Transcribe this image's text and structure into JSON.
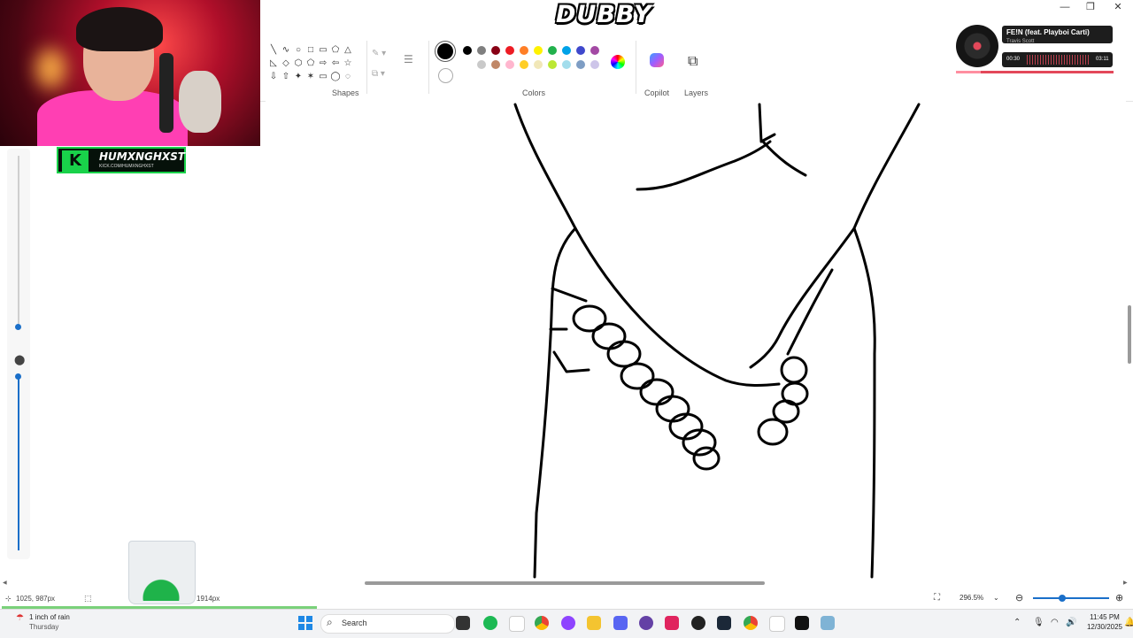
{
  "window": {
    "overlay_logo": "DUBBY",
    "minimize": "—",
    "maximize": "❐",
    "close": "✕"
  },
  "ribbon": {
    "shapes_label": "Shapes",
    "colors_label": "Colors",
    "copilot_label": "Copilot",
    "layers_label": "Layers",
    "shape_glyphs": [
      "╲",
      "∿",
      "○",
      "□",
      "▭",
      "⬠",
      "△",
      "◺",
      "◇",
      "⬡",
      "⬠",
      "⇨",
      "⇦",
      "☆",
      "⇩",
      "⇧",
      "✦",
      "✶",
      "▭",
      "◯",
      "◌"
    ],
    "colors_row1": [
      "#000000",
      "#7f7f7f",
      "#880015",
      "#ed1c24",
      "#ff7f27",
      "#fff200",
      "#22b14c",
      "#00a2e8",
      "#3f48cc",
      "#a349a4"
    ],
    "colors_row2": [
      "#ffffff",
      "#c3c3c3",
      "#b97a57",
      "#ffaec9",
      "#ffc90e",
      "#efe4b0",
      "#b5e61d",
      "#99d9ea",
      "#7092be",
      "#c8bfe7"
    ],
    "current_color": "#000000"
  },
  "stream": {
    "channel_name": "HUMXNGHXST",
    "channel_url": "KICK.COM/HUMXNGHXST",
    "kick_letter": "K"
  },
  "now_playing": {
    "title": "FE!N (feat. Playboi Carti)",
    "artist": "Travis Scott",
    "elapsed": "00:30",
    "duration": "03:11",
    "progress": 0.16
  },
  "status": {
    "cursor_pos": "1025, 987px",
    "canvas_size": "1914px",
    "zoom": "296.5%",
    "zoom_out_icon": "⊖",
    "zoom_in_icon": "⊕"
  },
  "taskbar": {
    "weather_title": "1 inch of rain",
    "weather_sub": "Thursday",
    "search_placeholder": "Search",
    "time": "11:45 PM",
    "date": "12/30/2025"
  }
}
